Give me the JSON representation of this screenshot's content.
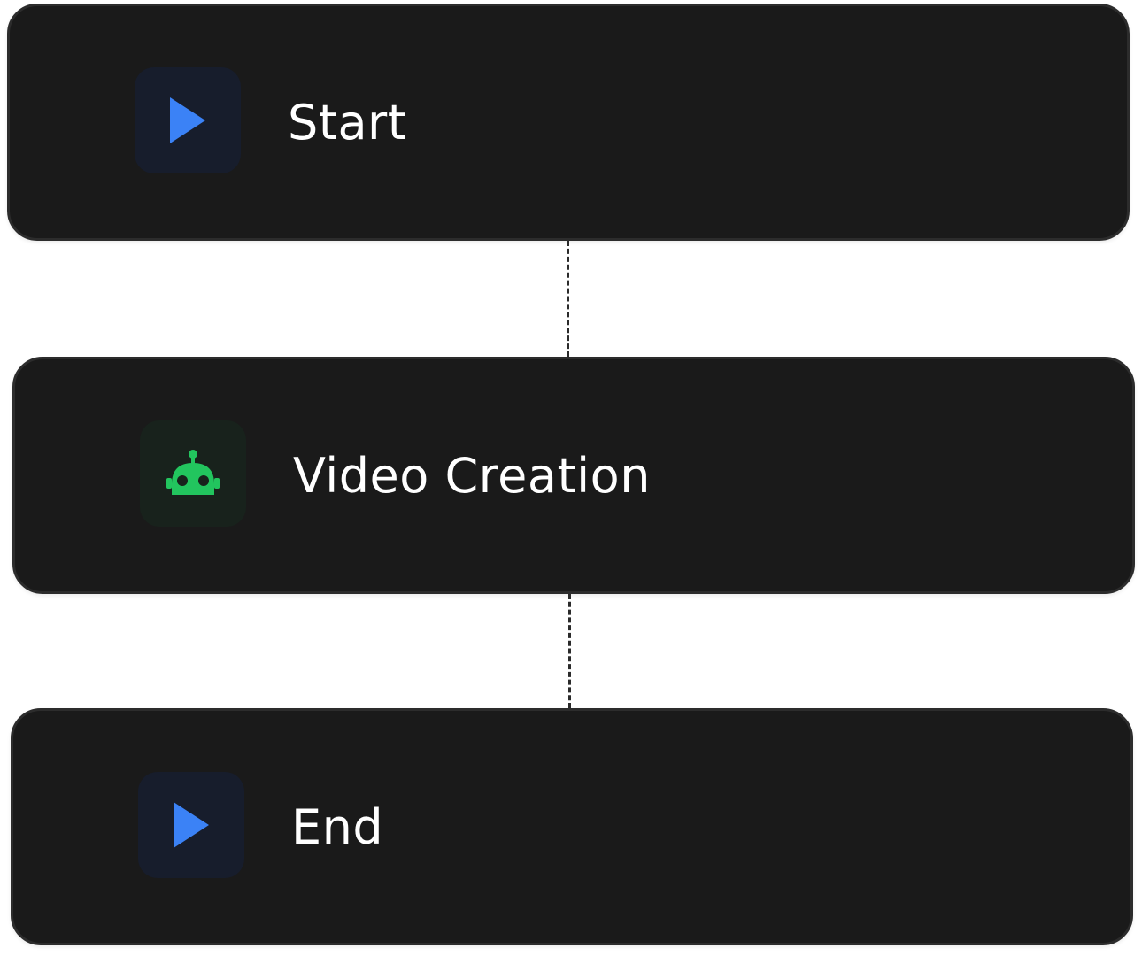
{
  "diagram": {
    "nodes": [
      {
        "id": "start",
        "label": "Start",
        "icon": "play-icon",
        "accent": "#3b82f6"
      },
      {
        "id": "video_creation",
        "label": "Video Creation",
        "icon": "robot-icon",
        "accent": "#22c55e"
      },
      {
        "id": "end",
        "label": "End",
        "icon": "play-icon",
        "accent": "#3b82f6"
      }
    ],
    "edges": [
      {
        "from": "start",
        "to": "video_creation",
        "style": "dashed"
      },
      {
        "from": "video_creation",
        "to": "end",
        "style": "dashed"
      }
    ]
  },
  "colors": {
    "node_background": "#1a1a1a",
    "node_border": "#2c2c2c",
    "blue_tile": "#171d2c",
    "green_tile": "#18221c",
    "text": "#ffffff"
  }
}
